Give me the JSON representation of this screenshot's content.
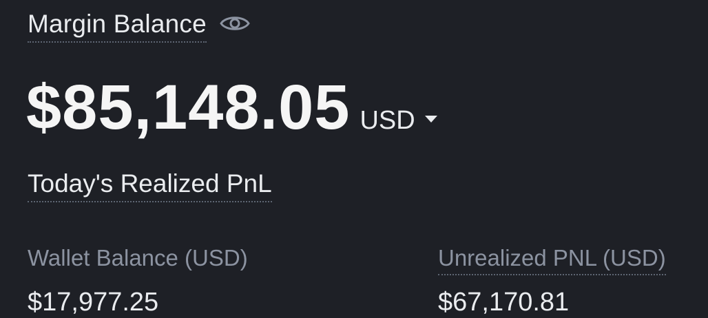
{
  "margin_balance": {
    "label": "Margin Balance",
    "visibility_icon": "eye-icon"
  },
  "balance": {
    "value": "$85,148.05",
    "currency": "USD",
    "currency_dropdown_icon": "caret-down-icon"
  },
  "realized_pnl": {
    "label": "Today's Realized PnL"
  },
  "wallet_balance": {
    "label": "Wallet Balance (USD)",
    "value": "$17,977.25"
  },
  "unrealized_pnl": {
    "label": "Unrealized PNL (USD)",
    "value": "$67,170.81"
  },
  "colors": {
    "background": "#1e2026",
    "primary_text": "#eaecef",
    "secondary_text": "#8c93a1"
  }
}
